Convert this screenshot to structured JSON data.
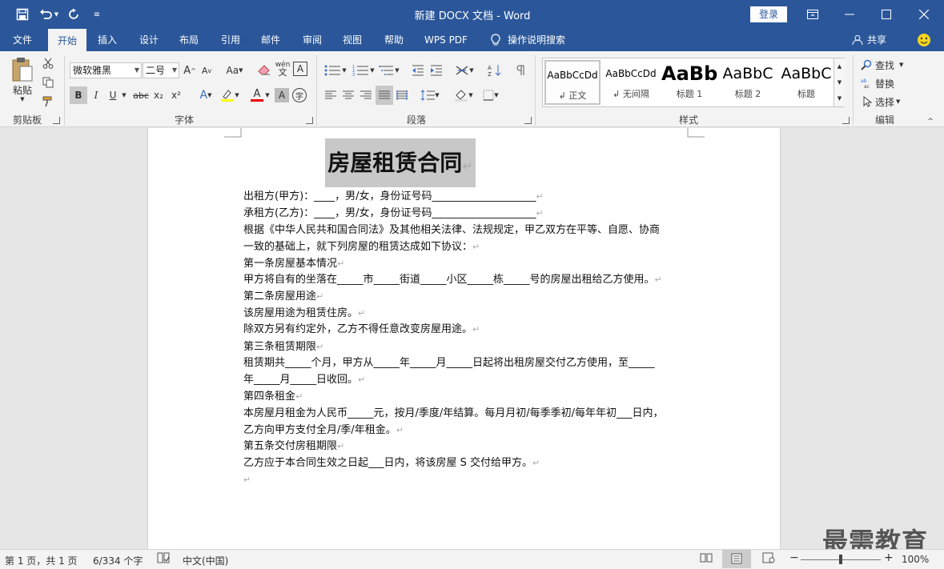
{
  "window": {
    "title": "新建 DOCX 文档 - Word",
    "login": "登录"
  },
  "tabs": [
    {
      "label": "文件"
    },
    {
      "label": "开始"
    },
    {
      "label": "插入"
    },
    {
      "label": "设计"
    },
    {
      "label": "布局"
    },
    {
      "label": "引用"
    },
    {
      "label": "邮件"
    },
    {
      "label": "审阅"
    },
    {
      "label": "视图"
    },
    {
      "label": "帮助"
    },
    {
      "label": "WPS PDF"
    },
    {
      "label": "操作说明搜索"
    }
  ],
  "share": "共享",
  "clipboard": {
    "paste": "粘贴",
    "group": "剪贴板"
  },
  "font": {
    "name": "微软雅黑",
    "size": "二号",
    "group": "字体",
    "change_case": "Aa",
    "bold": "B",
    "italic": "I",
    "underline": "U",
    "strike": "abc",
    "sub": "x₂",
    "sup": "x²",
    "wen": "文",
    "font_color_A": "A",
    "glow_A": "A",
    "enlarge": "A",
    "shrink": "A",
    "char_shade": "A",
    "phonetic": "wén",
    "enclose": "字"
  },
  "paragraph": {
    "group": "段落"
  },
  "styles": {
    "group": "样式",
    "items": [
      {
        "preview": "AaBbCcDd",
        "name": "↲ 正文"
      },
      {
        "preview": "AaBbCcDd",
        "name": "↲ 无间隔"
      },
      {
        "preview": "AaBb",
        "name": "标题 1"
      },
      {
        "preview": "AaBbC",
        "name": "标题 2"
      },
      {
        "preview": "AaBbC",
        "name": "标题"
      }
    ]
  },
  "editing": {
    "group": "编辑",
    "find": "查找",
    "replace": "替换",
    "select": "选择"
  },
  "document": {
    "title": "房屋租赁合同",
    "lines": [
      "出租方(甲方)：____，男/女，身份证号码____________________",
      "承租方(乙方)：____，男/女，身份证号码____________________",
      "根据《中华人民共和国合同法》及其他相关法律、法规规定，甲乙双方在平等、自愿、协商",
      "一致的基础上，就下列房屋的租赁达成如下协议：",
      "第一条房屋基本情况",
      "甲方将自有的坐落在_____市_____街道_____小区_____栋_____号的房屋出租给乙方使用。",
      "第二条房屋用途",
      "该房屋用途为租赁住房。",
      "除双方另有约定外，乙方不得任意改变房屋用途。",
      "第三条租赁期限",
      "租赁期共_____个月，甲方从_____年_____月_____日起将出租房屋交付乙方使用，至_____",
      "年_____月_____日收回。",
      "第四条租金",
      "本房屋月租金为人民币_____元，按月/季度/年结算。每月月初/每季季初/每年年初___日内，",
      "乙方向甲方支付全月/季/年租金。",
      "第五条交付房租期限",
      "乙方应于本合同生效之日起___日内，将该房屋 S 交付给甲方。",
      ""
    ]
  },
  "status": {
    "page": "第 1 页，共 1 页",
    "words": "6/334 个字",
    "lang": "中文(中国)",
    "zoom": "100%"
  },
  "watermark": "最需教育"
}
